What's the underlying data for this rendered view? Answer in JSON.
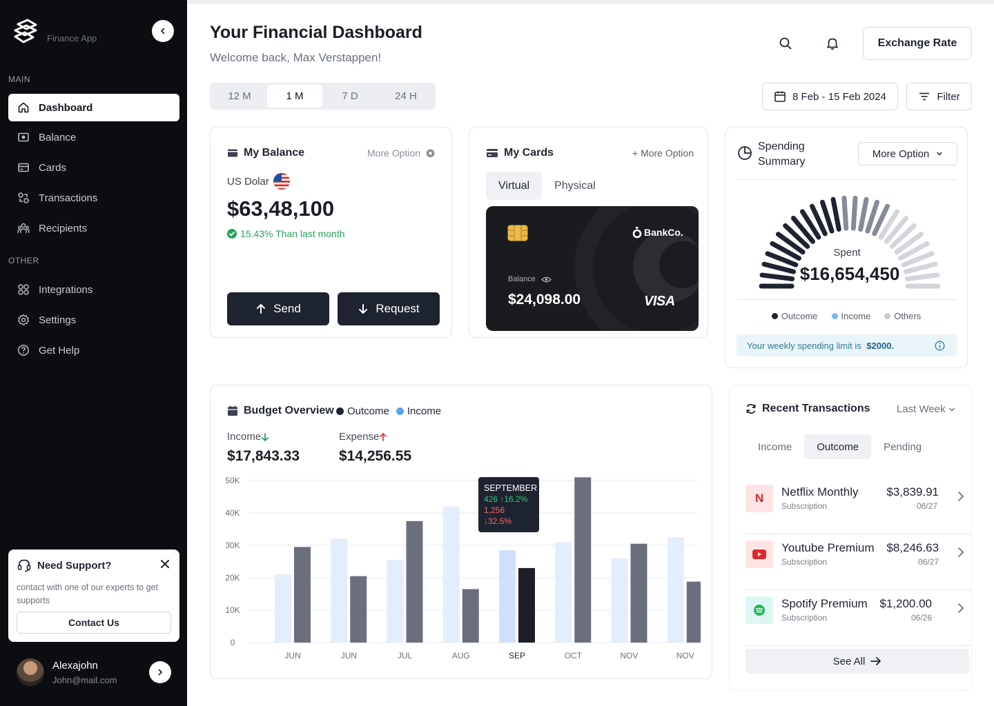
{
  "app": {
    "name": "Finance App"
  },
  "sidebar": {
    "main_title": "MAIN",
    "other_title": "OTHER",
    "main_items": [
      {
        "label": "Dashboard",
        "icon": "home-icon"
      },
      {
        "label": "Balance",
        "icon": "money-icon"
      },
      {
        "label": "Cards",
        "icon": "card-icon"
      },
      {
        "label": "Transactions",
        "icon": "transactions-icon"
      },
      {
        "label": "Recipients",
        "icon": "recipients-icon"
      }
    ],
    "other_items": [
      {
        "label": "Integrations",
        "icon": "integrations-icon"
      },
      {
        "label": "Settings",
        "icon": "gear-icon"
      },
      {
        "label": "Get Help",
        "icon": "help-icon"
      }
    ],
    "support": {
      "title": "Need Support?",
      "desc": "contact with one of our experts to get supports",
      "button": "Contact Us"
    },
    "user": {
      "name": "Alexajohn",
      "email": "John@mail.com"
    }
  },
  "header": {
    "title": "Your Financial Dashboard",
    "subtitle": "Welcome back, Max Verstappen!",
    "exchange_label": "Exchange Rate",
    "ranges": [
      "12 M",
      "1 M",
      "7 D",
      "24 H"
    ],
    "active_range": "1 M",
    "date_range": "8 Feb - 15 Feb 2024",
    "filter_label": "Filter"
  },
  "balance": {
    "title": "My Balance",
    "more": "More Option",
    "currency": "US Dolar",
    "amount": "$63,48,100",
    "change": "15.43% Than last month",
    "send": "Send",
    "request": "Request"
  },
  "cards": {
    "title": "My Cards",
    "more": "+ More Option",
    "tabs": [
      "Virtual",
      "Physical"
    ],
    "bank": "BankCo.",
    "balance_label": "Balance",
    "balance": "$24,098.00",
    "network": "VISA"
  },
  "spending": {
    "title_line1": "Spending",
    "title_line2": "Summary",
    "more": "More Option",
    "spent_label": "Spent",
    "amount": "$16,654,450",
    "legend": [
      {
        "label": "Outcome",
        "color": "#1e2330"
      },
      {
        "label": "Income",
        "color": "#7fb2f5"
      },
      {
        "label": "Others",
        "color": "#c7c9ce"
      }
    ],
    "limit_text": "Your weekly spending limit is ",
    "limit_value": "$2000."
  },
  "budget": {
    "title": "Budget Overview",
    "legend_outcome": "Outcome",
    "legend_income": "Income",
    "income_label": "Income",
    "income_value": "$17,843.33",
    "expense_label": "Expense",
    "expense_value": "$14,256.55",
    "tooltip": {
      "month": "SEPTEMBER",
      "income": "426",
      "income_pct": "16.2%",
      "outcome": "1,256",
      "outcome_pct": "32.5%"
    }
  },
  "chart_data": {
    "type": "bar",
    "categories": [
      "JUN",
      "JUN",
      "JUL",
      "AUG",
      "SEP",
      "OCT",
      "NOV",
      "NOV"
    ],
    "y_ticks": [
      "0",
      "10K",
      "20K",
      "30K",
      "40K",
      "50K"
    ],
    "ylim": [
      0,
      50000
    ],
    "highlight_index": 4,
    "series": [
      {
        "name": "Income",
        "color": "#e4edfc",
        "values": [
          21000,
          32000,
          25500,
          42000,
          28500,
          31000,
          26000,
          32500
        ]
      },
      {
        "name": "Outcome",
        "color": "#6b6f7d",
        "values": [
          29500,
          20500,
          37500,
          16500,
          23000,
          51000,
          30500,
          18800
        ]
      }
    ]
  },
  "transactions": {
    "title": "Recent Transactions",
    "period": "Last Week",
    "tabs": [
      "Income",
      "Outcome",
      "Pending"
    ],
    "active_tab": "Outcome",
    "items": [
      {
        "name": "Netflix Monthly",
        "type": "Subscription",
        "amount": "$3,839.91",
        "date": "06/27",
        "logo": "N"
      },
      {
        "name": "Youtube Premium",
        "type": "Subscription",
        "amount": "$8,246.63",
        "date": "06/27"
      },
      {
        "name": "Spotify Premium",
        "type": "Subscription",
        "amount": "$1,200.00",
        "date": "06/26"
      }
    ],
    "see_all": "See All"
  }
}
